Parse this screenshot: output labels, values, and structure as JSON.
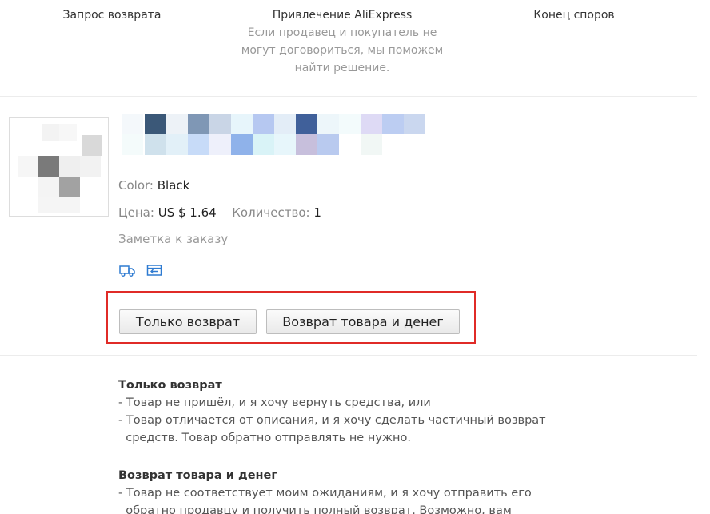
{
  "steps": [
    {
      "title": "Запрос возврата"
    },
    {
      "title": "Привлечение AliExpress",
      "desc_lines": [
        "Если продавец и покупатель не",
        "могут договориться, мы поможем",
        "найти решение."
      ]
    },
    {
      "title": "Конец споров"
    }
  ],
  "product": {
    "color_label": "Color:",
    "color_value": "Black",
    "price_label": "Цена:",
    "price_value": "US $ 1.64",
    "qty_label": "Количество:",
    "qty_value": "1",
    "note": "Заметка к заказу",
    "icons": [
      "shipping-truck-icon",
      "return-box-icon"
    ]
  },
  "actions": {
    "refund_only": "Только возврат",
    "return_and_refund": "Возврат товара и денег"
  },
  "explanations": {
    "refund_only": {
      "heading": "Только возврат",
      "lines": [
        "- Товар не пришёл, и я хочу вернуть средства, или",
        "- Товар отличается от описания, и я хочу сделать частичный возврат",
        "  средств. Товар обратно отправлять не нужно."
      ]
    },
    "return_and_refund": {
      "heading": "Возврат товара и денег",
      "lines": [
        "- Товар не соответствует моим ожиданиям, и я хочу отправить его",
        "  обратно продавцу и получить полный возврат. Возможно, вам"
      ]
    }
  },
  "colors": {
    "highlight_border": "#e02b27",
    "muted_text": "#999999",
    "icon_blue": "#2f7bd1"
  }
}
